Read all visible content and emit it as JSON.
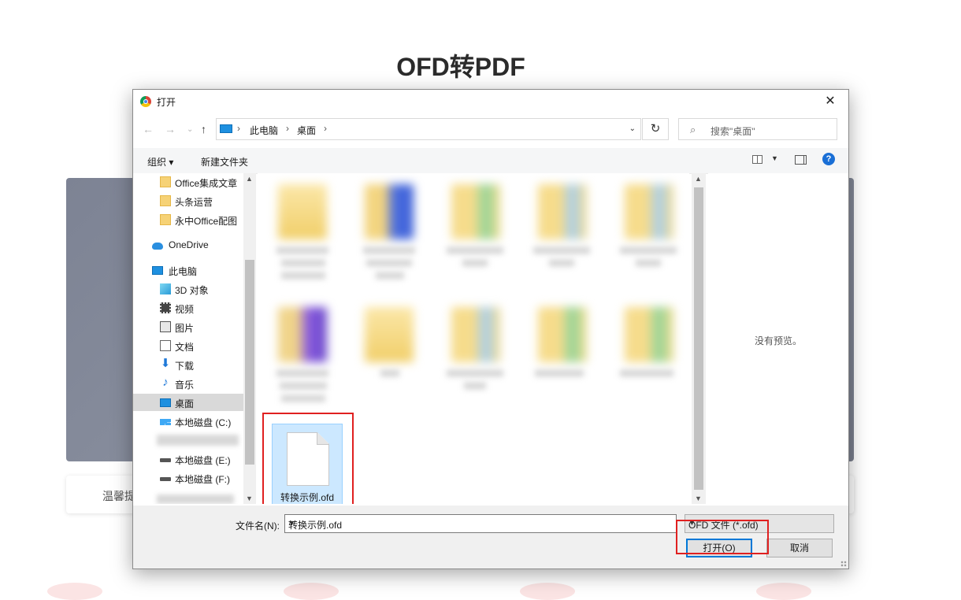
{
  "page": {
    "title": "OFD转PDF",
    "tip_text": "温馨提"
  },
  "dialog": {
    "title": "打开",
    "close_glyph": "✕",
    "nav": {
      "back": "←",
      "forward": "→",
      "recent": "⌄",
      "up": "↑",
      "breadcrumb": [
        "此电脑",
        "桌面"
      ],
      "separator": "›",
      "refresh": "↻",
      "search_placeholder": "搜索\"桌面\""
    },
    "toolbar": {
      "organize": "组织 ▾",
      "new_folder": "新建文件夹",
      "help": "?"
    },
    "sidebar": {
      "items": [
        {
          "label": "Office集成文章",
          "icon": "folder-icon"
        },
        {
          "label": "头条运营",
          "icon": "folder-icon"
        },
        {
          "label": "永中Office配图",
          "icon": "folder-icon"
        },
        {
          "label": "OneDrive",
          "icon": "onedrive-icon"
        },
        {
          "label": "此电脑",
          "icon": "computer-icon"
        },
        {
          "label": "3D 对象",
          "icon": "3d-objects-icon"
        },
        {
          "label": "视频",
          "icon": "video-icon"
        },
        {
          "label": "图片",
          "icon": "pictures-icon"
        },
        {
          "label": "文档",
          "icon": "documents-icon"
        },
        {
          "label": "下载",
          "icon": "downloads-icon"
        },
        {
          "label": "音乐",
          "icon": "music-icon"
        },
        {
          "label": "桌面",
          "icon": "desktop-icon"
        },
        {
          "label": "本地磁盘 (C:)",
          "icon": "windows-drive-icon"
        },
        {
          "label": "本地磁盘 (E:)",
          "icon": "drive-icon"
        },
        {
          "label": "本地磁盘 (F:)",
          "icon": "drive-icon"
        }
      ],
      "selected": "桌面"
    },
    "files": {
      "selected_file": "转换示例.ofd"
    },
    "preview_text": "没有预览。",
    "bottom": {
      "filename_label": "文件名(N):",
      "filename_value": "转换示例.ofd",
      "filetype": "OFD 文件 (*.ofd)",
      "open_button": "打开(O)",
      "cancel_button": "取消"
    }
  },
  "colors": {
    "highlight_box": "#e02020",
    "selection": "#cce8ff",
    "accent": "#0078d7"
  }
}
